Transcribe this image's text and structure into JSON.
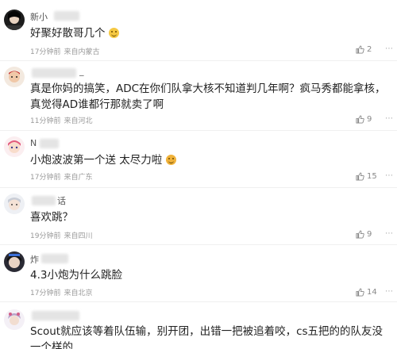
{
  "comments": [
    {
      "username": "新小",
      "text": "好聚好散哥几个",
      "emoji": "smile-emoji",
      "time": "17分钟前",
      "location": "来自内蒙古",
      "likes": "2"
    },
    {
      "username": "_",
      "text": "真是你妈的搞笑，ADC在你们队拿大核不知道判几年啊？疯马秀都能拿核，真觉得AD谁都行那就卖了啊",
      "emoji": "",
      "time": "11分钟前",
      "location": "来自河北",
      "likes": "9"
    },
    {
      "username": "N",
      "text": "小炮波波第一个送 太尽力啦",
      "emoji": "laugh-emoji",
      "time": "17分钟前",
      "location": "来自广东",
      "likes": "15"
    },
    {
      "username": "话",
      "text": "喜欢跳？",
      "emoji": "",
      "time": "19分钟前",
      "location": "来自四川",
      "likes": "9"
    },
    {
      "username": "炸",
      "text": "4.3小炮为什么跳脸",
      "emoji": "",
      "time": "17分钟前",
      "location": "来自北京",
      "likes": "14"
    },
    {
      "username": "",
      "text": "Scout就应该等着队伍输，别开团，出错一把被追着咬，cs五把的的队友没一个样的",
      "emoji": "",
      "time": "",
      "location": "",
      "likes": ""
    }
  ],
  "icons": {
    "like": "thumbs-up-icon",
    "more": "more-icon"
  },
  "colors": {
    "meta": "#999999",
    "text": "#222222",
    "divider": "#f0f0f0"
  }
}
